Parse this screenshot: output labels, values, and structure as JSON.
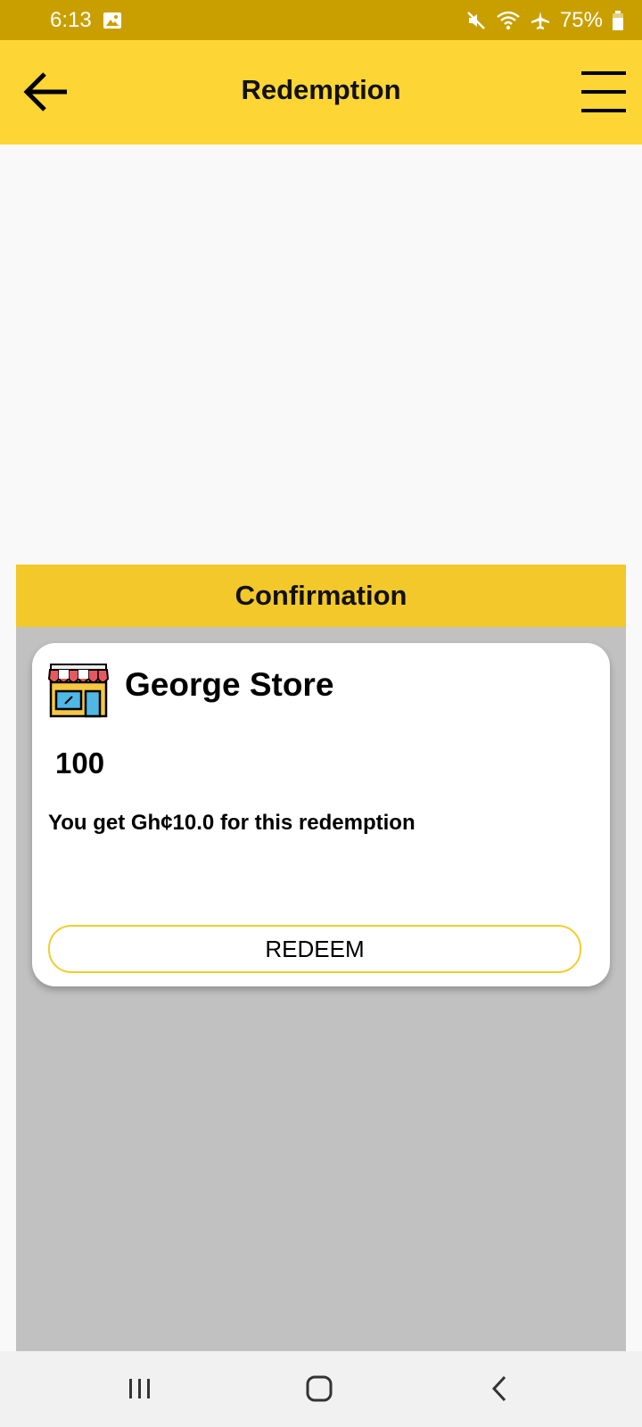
{
  "status_bar": {
    "time": "6:13",
    "battery": "75%",
    "icons": [
      "image-icon",
      "mute-icon",
      "wifi-icon",
      "airplane-mode-icon",
      "battery-icon"
    ]
  },
  "app_bar": {
    "title": "Redemption",
    "back_icon": "arrow-left-icon",
    "menu_icon": "hamburger-menu-icon"
  },
  "dialog": {
    "title": "Confirmation",
    "card": {
      "store_icon": "storefront-icon",
      "store_name": "George Store",
      "points": "100",
      "message": "You get Gh¢10.0 for this redemption",
      "button_label": "REDEEM"
    }
  },
  "nav_bar": {
    "icons": [
      "recent-apps-icon",
      "home-icon",
      "back-icon"
    ]
  },
  "colors": {
    "status_bar": "#c99f00",
    "app_bar": "#fdd535",
    "dialog_header": "#f2c82a",
    "overlay": "#c1c1c1",
    "button_border": "#f2cd2c"
  }
}
